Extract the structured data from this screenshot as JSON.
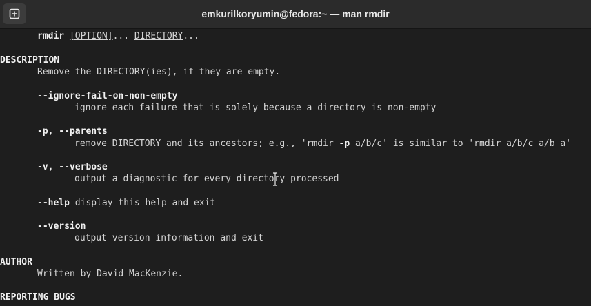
{
  "titlebar": {
    "new_tab_icon": "plus-square-icon",
    "title": "emkurilkoryumin@fedora:~ — man rmdir"
  },
  "synopsis": {
    "cmd": "rmdir",
    "option": "[OPTION]",
    "dots": "...",
    "directory": "DIRECTORY",
    "dots2": "..."
  },
  "description": {
    "heading": "DESCRIPTION",
    "text": "Remove the DIRECTORY(ies), if they are empty."
  },
  "options": {
    "ignore": {
      "flag": "--ignore-fail-on-non-empty",
      "desc": "ignore each failure that is solely because a directory is non-empty"
    },
    "parents": {
      "flag": "-p, --parents",
      "desc_a": "remove DIRECTORY and its ancestors; e.g., 'rmdir ",
      "desc_flag": "-p",
      "desc_b": " a/b/c' is similar to 'rmdir a/b/c a/b a'"
    },
    "verbose": {
      "flag": "-v, --verbose",
      "desc": "output a diagnostic for every directory processed"
    },
    "help": {
      "flag": "--help",
      "desc": "display this help and exit"
    },
    "version": {
      "flag": "--version",
      "desc": "output version information and exit"
    }
  },
  "author": {
    "heading": "AUTHOR",
    "text": "Written by David MacKenzie."
  },
  "reporting": {
    "heading": "REPORTING BUGS"
  }
}
